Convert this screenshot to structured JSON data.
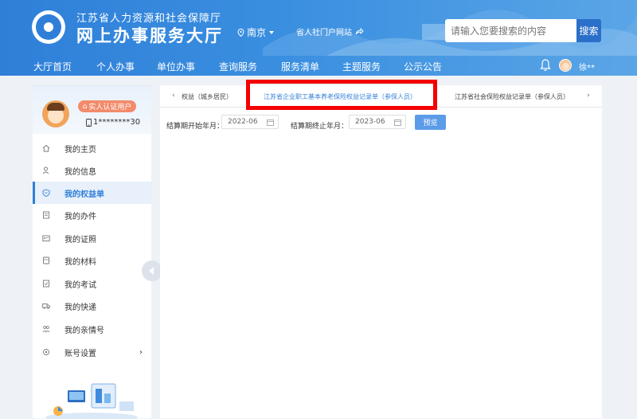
{
  "header": {
    "org_name": "江苏省人力资源和社会保障厅",
    "hall_name": "网上办事服务大厅",
    "city": "南京",
    "portal_link": "省人社门户网站",
    "search_placeholder": "请输入您要搜索的内容",
    "search_button": "搜索",
    "user_name": "徐**"
  },
  "nav": {
    "items": [
      "大厅首页",
      "个人办事",
      "单位办事",
      "查询服务",
      "服务清单",
      "主题服务",
      "公示公告"
    ]
  },
  "sidebar": {
    "badge": "实人认证用户",
    "phone": "1********30",
    "items": [
      {
        "label": "我的主页",
        "icon": "home-icon"
      },
      {
        "label": "我的信息",
        "icon": "user-icon"
      },
      {
        "label": "我的权益单",
        "icon": "shield-heart-icon"
      },
      {
        "label": "我的办件",
        "icon": "document-icon"
      },
      {
        "label": "我的证照",
        "icon": "id-card-icon"
      },
      {
        "label": "我的材料",
        "icon": "folder-icon"
      },
      {
        "label": "我的考试",
        "icon": "exam-icon"
      },
      {
        "label": "我的快递",
        "icon": "truck-icon"
      },
      {
        "label": "我的亲情号",
        "icon": "family-icon"
      },
      {
        "label": "账号设置",
        "icon": "gear-icon"
      }
    ]
  },
  "tabs": {
    "items": [
      "权益（城乡居民）",
      "江苏省企业职工基本养老保险权益记录单（参保人员）",
      "江苏省社会保险权益记录单（参保人员）"
    ],
    "active_index": 1
  },
  "filters": {
    "start_label": "结算期开始年月：",
    "start_value": "2022-06",
    "end_label": "结算期终止年月：",
    "end_value": "2023-06",
    "preview_button": "预览"
  },
  "colors": {
    "brand": "#2f7fd8",
    "highlight": "#f40000",
    "badge": "#f28b6b"
  }
}
